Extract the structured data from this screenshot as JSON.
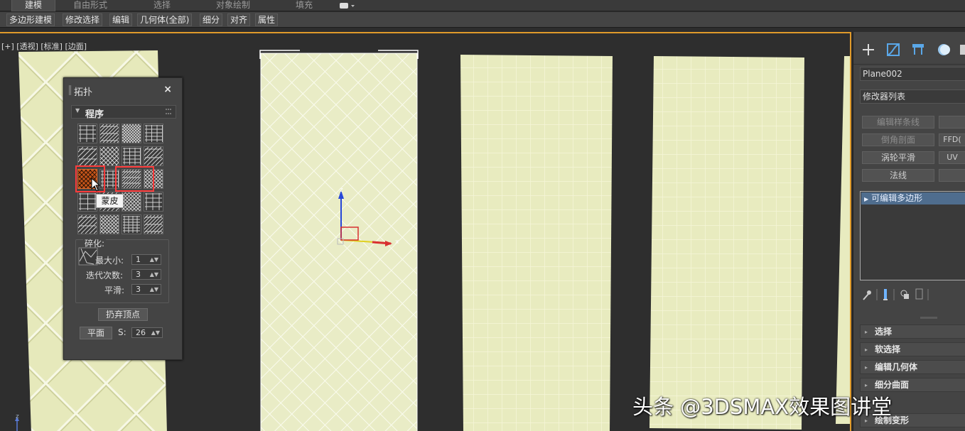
{
  "ribbon": {
    "tabs": [
      "建模",
      "自由形式",
      "选择",
      "对象绘制",
      "填充"
    ],
    "active_tab": "建模",
    "extra_icon": "display-toggle-icon"
  },
  "subbar": {
    "buttons": [
      "多边形建模",
      "修改选择",
      "编辑",
      "几何体(全部)",
      "细分",
      "对齐",
      "属性"
    ]
  },
  "viewport": {
    "label": "[+] [透视] [标准] [边面]",
    "gizmo": {
      "z": "z",
      "x": "x"
    },
    "corner_axis": "z"
  },
  "topology_panel": {
    "title": "拓扑",
    "close_glyph": "×",
    "section": "程序",
    "tooltip": "蒙皮",
    "fragment_group": "碎化:",
    "size_label": "最大小:",
    "size_value": "1",
    "iterations_label": "迭代次数:",
    "iterations_value": "3",
    "smooth_label": "平滑:",
    "smooth_value": "3",
    "discard_vertices": "扔弃顶点",
    "plane_button": "平面",
    "s_label": "S:",
    "s_value": "26"
  },
  "command_panel": {
    "object_name": "Plane002",
    "modifier_list": "修改器列表",
    "modifier_buttons": [
      "编辑样条线",
      "",
      "倒角剖面",
      "FFD(",
      "涡轮平滑",
      "UV",
      "法线",
      ""
    ],
    "stack_item": "可编辑多边形",
    "rollouts": [
      "选择",
      "软选择",
      "编辑几何体",
      "细分曲面",
      "绘制变形"
    ]
  },
  "watermark": "头条 @3DSMAX效果图讲堂",
  "colors": {
    "tile": "#e8ecc0",
    "active_border": "#e09a2a",
    "highlight": "#ff3b3b"
  }
}
